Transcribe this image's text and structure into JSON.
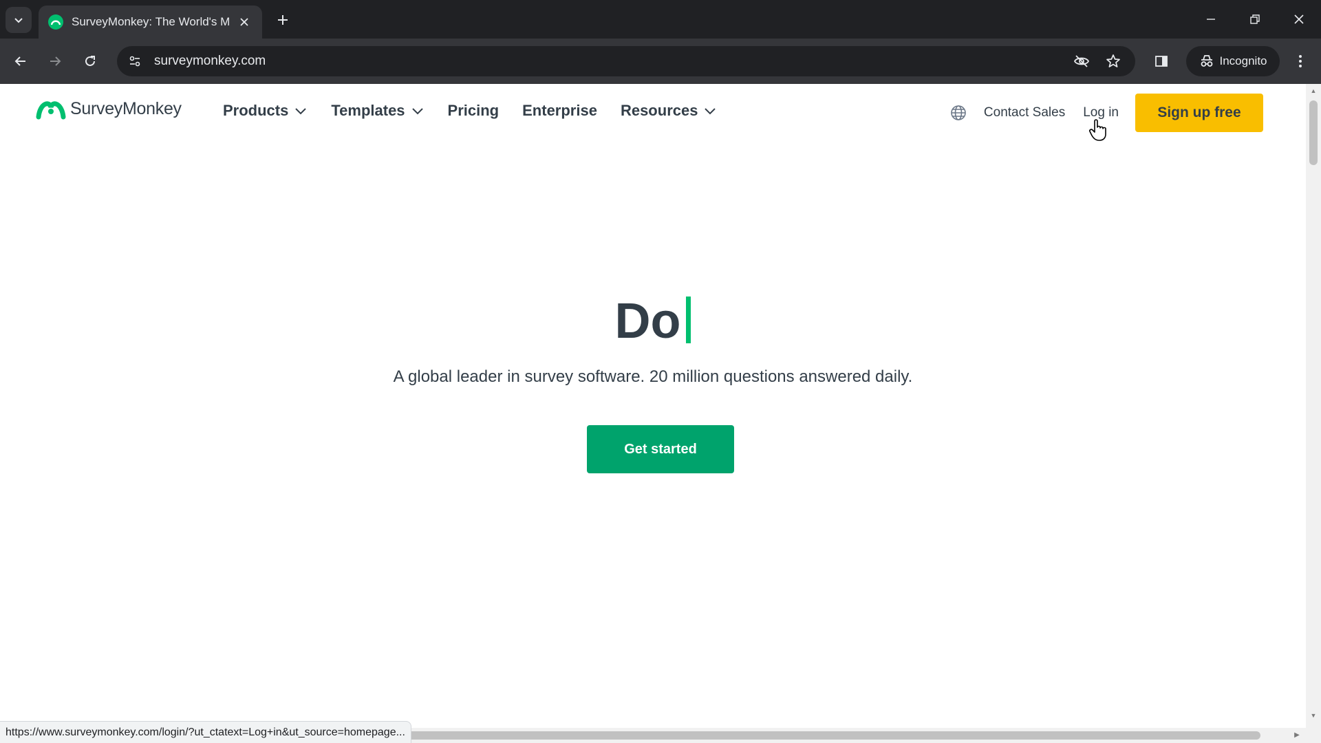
{
  "browser": {
    "tab_title": "SurveyMonkey: The World's Mo",
    "url": "surveymonkey.com",
    "incognito_label": "Incognito",
    "status_url": "https://www.surveymonkey.com/login/?ut_ctatext=Log+in&ut_source=homepage..."
  },
  "header": {
    "logo_text": "SurveyMonkey",
    "nav": {
      "products": "Products",
      "templates": "Templates",
      "pricing": "Pricing",
      "enterprise": "Enterprise",
      "resources": "Resources"
    },
    "contact_sales": "Contact Sales",
    "log_in": "Log in",
    "sign_up": "Sign up free"
  },
  "hero": {
    "title": "Do",
    "subtitle": "A global leader in survey software. 20 million questions answered daily.",
    "cta": "Get started"
  },
  "colors": {
    "brand_green": "#00bf6f",
    "cta_green": "#00a36c",
    "signup_yellow": "#f9be00",
    "text_dark": "#333e48"
  }
}
